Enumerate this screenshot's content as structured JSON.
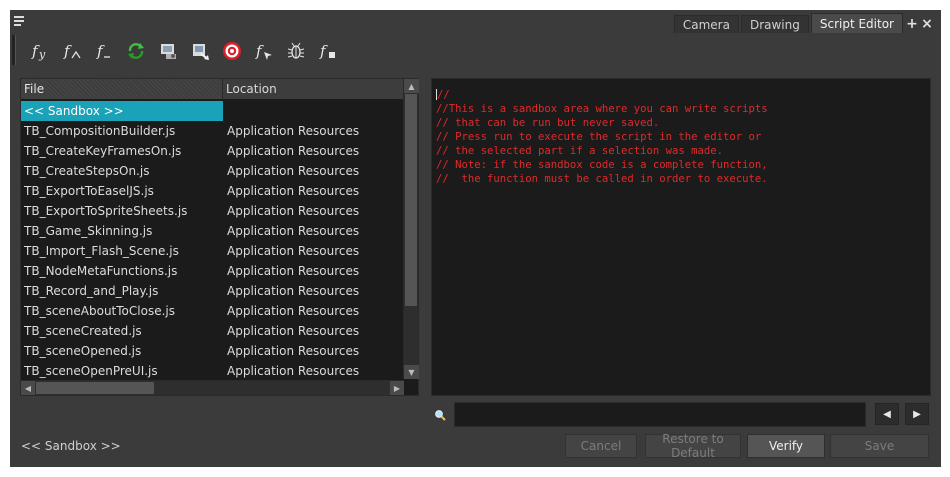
{
  "tabs": [
    {
      "label": "Camera",
      "active": false
    },
    {
      "label": "Drawing",
      "active": false
    },
    {
      "label": "Script Editor",
      "active": true
    }
  ],
  "window_controls": {
    "add": "+",
    "close": "×"
  },
  "toolbar": {
    "icons": [
      "new-function-icon",
      "rename-function-icon",
      "delete-function-icon",
      "refresh-icon",
      "open-script-icon",
      "import-script-icon",
      "target-icon",
      "set-target-icon",
      "debug-icon",
      "function-list-icon"
    ]
  },
  "file_table": {
    "columns": {
      "file": "File",
      "location": "Location"
    },
    "rows": [
      {
        "file": "<< Sandbox >>",
        "location": "",
        "selected": true
      },
      {
        "file": "TB_CompositionBuilder.js",
        "location": "Application Resources",
        "selected": false
      },
      {
        "file": "TB_CreateKeyFramesOn.js",
        "location": "Application Resources",
        "selected": false
      },
      {
        "file": "TB_CreateStepsOn.js",
        "location": "Application Resources",
        "selected": false
      },
      {
        "file": "TB_ExportToEaselJS.js",
        "location": "Application Resources",
        "selected": false
      },
      {
        "file": "TB_ExportToSpriteSheets.js",
        "location": "Application Resources",
        "selected": false
      },
      {
        "file": "TB_Game_Skinning.js",
        "location": "Application Resources",
        "selected": false
      },
      {
        "file": "TB_Import_Flash_Scene.js",
        "location": "Application Resources",
        "selected": false
      },
      {
        "file": "TB_NodeMetaFunctions.js",
        "location": "Application Resources",
        "selected": false
      },
      {
        "file": "TB_Record_and_Play.js",
        "location": "Application Resources",
        "selected": false
      },
      {
        "file": "TB_sceneAboutToClose.js",
        "location": "Application Resources",
        "selected": false
      },
      {
        "file": "TB_sceneCreated.js",
        "location": "Application Resources",
        "selected": false
      },
      {
        "file": "TB_sceneOpened.js",
        "location": "Application Resources",
        "selected": false
      },
      {
        "file": "TB_sceneOpenPreUI.js",
        "location": "Application Resources",
        "selected": false
      }
    ]
  },
  "editor": {
    "lines": [
      "//",
      "//This is a sandbox area where you can write scripts",
      "// that can be run but never saved.",
      "// Press run to execute the script in the editor or",
      "// the selected part if a selection was made.",
      "// Note: if the sandbox code is a complete function,",
      "//  the function must be called in order to execute."
    ],
    "text_color": "#e02a2a"
  },
  "search": {
    "value": "",
    "prev_icon": "◀",
    "next_icon": "▶"
  },
  "status": {
    "current_file": "<< Sandbox >>"
  },
  "buttons": {
    "cancel": "Cancel",
    "restore": "Restore to Default",
    "verify": "Verify",
    "save": "Save"
  },
  "colors": {
    "selection": "#1aa2b8",
    "panel_bg": "#3b3b3b",
    "field_bg": "#1b1b1b"
  }
}
